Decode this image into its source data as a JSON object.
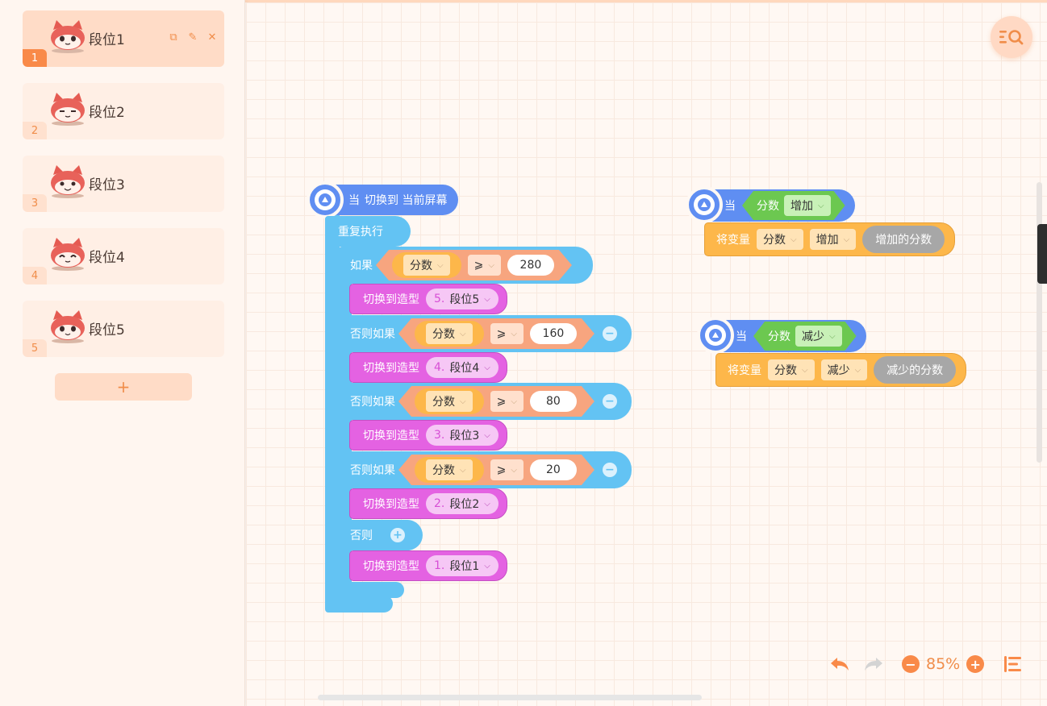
{
  "costumes": [
    {
      "index": "1",
      "name": "段位1",
      "selected": true
    },
    {
      "index": "2",
      "name": "段位2",
      "selected": false
    },
    {
      "index": "3",
      "name": "段位3",
      "selected": false
    },
    {
      "index": "4",
      "name": "段位4",
      "selected": false
    },
    {
      "index": "5",
      "name": "段位5",
      "selected": false
    }
  ],
  "add_costume_label": "+",
  "script_main": {
    "hat_when": "当",
    "hat_event": "切换到 当前屏幕",
    "repeat_label": "重复执行",
    "if_label": "如果",
    "elseif_label": "否则如果",
    "else_label": "否则",
    "switch_costume_label": "切换到造型",
    "variable": "分数",
    "operator": "⩾",
    "thresholds": [
      "280",
      "160",
      "80",
      "20"
    ],
    "costume_targets": [
      {
        "idx": "5.",
        "name": "段位5"
      },
      {
        "idx": "4.",
        "name": "段位4"
      },
      {
        "idx": "3.",
        "name": "段位3"
      },
      {
        "idx": "2.",
        "name": "段位2"
      },
      {
        "idx": "1.",
        "name": "段位1"
      }
    ]
  },
  "script_increase": {
    "when": "当",
    "variable": "分数",
    "event": "增加",
    "set_label": "将变量",
    "action": "增加",
    "value_label": "增加的分数"
  },
  "script_decrease": {
    "when": "当",
    "variable": "分数",
    "event": "减少",
    "set_label": "将变量",
    "action": "减少",
    "value_label": "减少的分数"
  },
  "zoom": {
    "level": "85%",
    "minus": "−",
    "plus": "+"
  },
  "colors": {
    "accent": "#f98a49",
    "control": "#63c3f3",
    "looks": "#e462e2",
    "events": "#5f8ef2",
    "data": "#fdb74a"
  },
  "icons": [
    "copy-icon",
    "edit-icon",
    "close-icon",
    "search-blocks-icon",
    "undo-icon",
    "redo-icon",
    "align-icon",
    "broadcast-icon"
  ]
}
